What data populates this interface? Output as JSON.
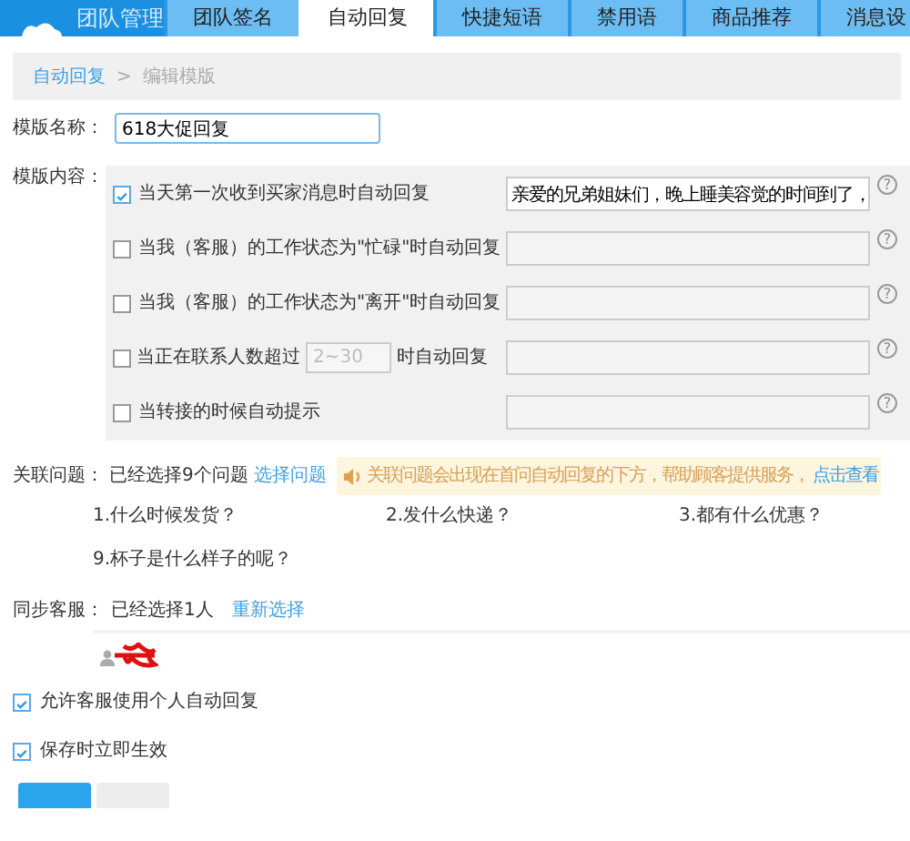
{
  "header": {
    "title": "团队管理",
    "tabs": [
      {
        "label": "团队签名",
        "selected": false
      },
      {
        "label": "自动回复",
        "selected": true
      },
      {
        "label": "快捷短语",
        "selected": false
      },
      {
        "label": "禁用语",
        "selected": false
      },
      {
        "label": "商品推荐",
        "selected": false
      },
      {
        "label": "消息设",
        "selected": false
      }
    ]
  },
  "breadcrumb": {
    "items": [
      {
        "label": "自动回复",
        "kind": "link"
      },
      {
        "label": "编辑模版",
        "kind": "current"
      }
    ],
    "separator": ">"
  },
  "template_name": {
    "label": "模版名称：",
    "value": "618大促回复"
  },
  "template_content": {
    "label": "模版内容：",
    "rules": [
      {
        "kind": "text",
        "checked": true,
        "label": "当天第一次收到买家消息时自动回复",
        "reply": "亲爱的兄弟姐妹们，晚上睡美容觉的时间到了，",
        "help": "?"
      },
      {
        "kind": "text",
        "checked": false,
        "label": "当我（客服）的工作状态为\"忙碌\"时自动回复",
        "help": "?"
      },
      {
        "kind": "text",
        "checked": false,
        "label": "当我（客服）的工作状态为\"离开\"时自动回复",
        "help": "?"
      },
      {
        "kind": "threshold",
        "checked": false,
        "label": "当正在联系人数超过",
        "placeholder": "2~30",
        "label_after": "时自动回复",
        "help": "?"
      },
      {
        "kind": "text",
        "checked": false,
        "label": "当转接的时候自动提示",
        "help": "?"
      }
    ]
  },
  "related_questions": {
    "label": "关联问题：",
    "summary": "已经选择9个问题",
    "select_link": "选择问题",
    "notice": {
      "text": "关联问题会出现在首问自动回复的下方，帮助顾客提供服务，",
      "link": "点击查看"
    },
    "questions": [
      "1.什么时候发货？",
      "2.发什么快递？",
      "3.都有什么优惠？",
      "9.杯子是什么样子的呢？"
    ]
  },
  "sync_agents": {
    "label": "同步客服：",
    "summary": "已经选择1人",
    "reselect_link": "重新选择"
  },
  "options": [
    {
      "label": "允许客服使用个人自动回复",
      "checked": true
    },
    {
      "label": "保存时立即生效",
      "checked": true
    }
  ],
  "buttons": [
    {
      "kind": "primary"
    },
    {
      "kind": "secondary"
    }
  ]
}
